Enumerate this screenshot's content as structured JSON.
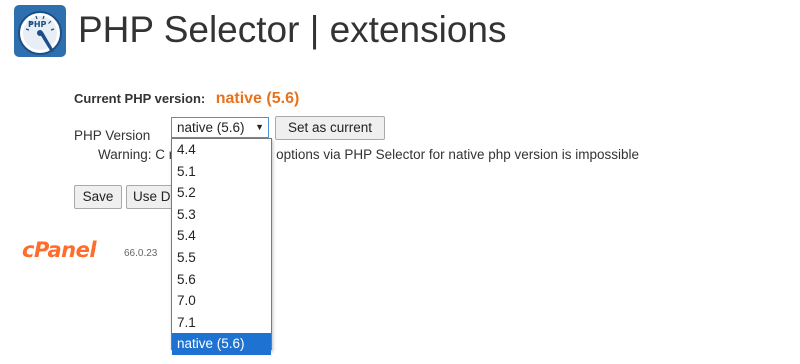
{
  "header": {
    "title": "PHP Selector | extensions",
    "logo_icon": "php-speedometer-icon",
    "logo_color": "#2e6fb0",
    "logo_text": "PHP"
  },
  "current_version": {
    "label": "Current PHP version:",
    "value": "native (5.6)",
    "accent_color": "#e8721c"
  },
  "php_version": {
    "label": "PHP Version",
    "selected": "native (5.6)",
    "set_button_label": "Set as current",
    "options": [
      "4.4",
      "5.1",
      "5.2",
      "5.3",
      "5.4",
      "5.5",
      "5.6",
      "7.0",
      "7.1",
      "native (5.6)"
    ],
    "highlighted_option": "native (5.6)"
  },
  "warning": {
    "text": "Warning: C                     modules and php options via PHP Selector for native php version is impossible"
  },
  "actions": {
    "save_label": "Save",
    "use_default_label": "Use D"
  },
  "footer": {
    "brand": "cPanel",
    "version": "66.0.23",
    "brand_color": "#ff6c2c"
  }
}
